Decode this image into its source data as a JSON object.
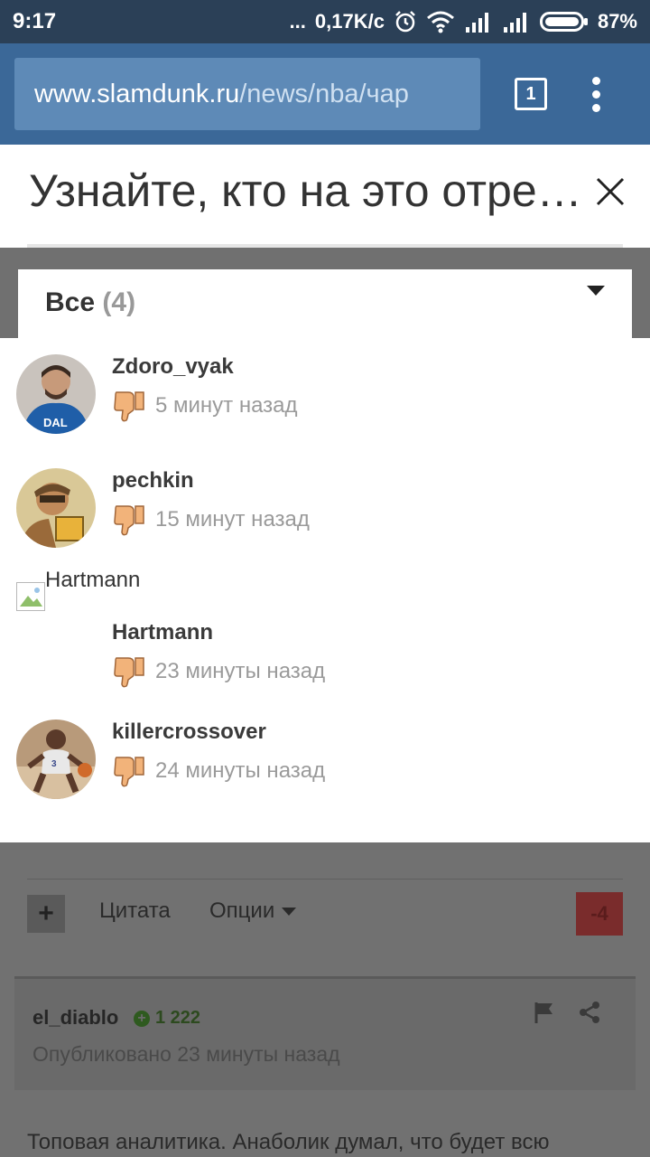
{
  "status": {
    "time": "9:17",
    "dots": "...",
    "speed": "0,17K/c",
    "battery": "87%"
  },
  "browser": {
    "url_domain": "www.slamdunk.ru",
    "url_path": "/news/nba/чар",
    "tab_count": "1"
  },
  "title": "Узнайте, кто на это отреагировал",
  "filter": {
    "label": "Все",
    "count": "(4)"
  },
  "users": [
    {
      "name": "Zdoro_vyak",
      "time": "5 минут назад",
      "reaction": "thumbs-down-icon"
    },
    {
      "name": "pechkin",
      "time": "15 минут назад",
      "reaction": "thumbs-down-icon"
    },
    {
      "name": "Hartmann",
      "alt": "Hartmann",
      "time": "23 минуты назад",
      "reaction": "thumbs-down-icon"
    },
    {
      "name": "killercrossover",
      "time": "24 минуты назад",
      "reaction": "thumbs-down-icon"
    }
  ],
  "page": {
    "plus": "+",
    "quote_label": "Цитата",
    "options_label": "Опции",
    "vote_count": "-4",
    "comment_author": "el_diablo",
    "comment_rep": "1 222",
    "comment_date": "Опубликовано 23 минуты назад",
    "comment_text": "Топовая аналитика. Анаболик думал, что будет всю"
  },
  "colors": {
    "status_bar": "#2b4057",
    "browser_bar": "#3b6898",
    "url_box": "#5e8ab7",
    "overlay": "#707070",
    "thumb": "#f2b37a"
  }
}
